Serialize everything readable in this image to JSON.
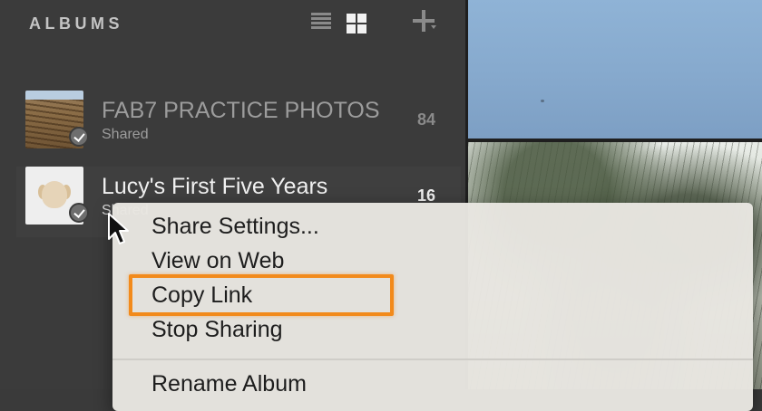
{
  "sidebar": {
    "title": "ALBUMS",
    "albums": [
      {
        "name": "FAB7 PRACTICE PHOTOS",
        "status": "Shared",
        "count": "84"
      },
      {
        "name": "Lucy's First Five Years",
        "status": "Shared",
        "count": "16"
      }
    ]
  },
  "context_menu": {
    "items": [
      "Share Settings...",
      "View on Web",
      "Copy Link",
      "Stop Sharing",
      "Rename Album"
    ],
    "highlighted": "Copy Link"
  },
  "icons": [
    "list-view-icon",
    "grid-view-icon",
    "add-icon",
    "shared-check-icon",
    "mouse-cursor-icon"
  ],
  "colors": {
    "sidebar_bg": "#3b3b3b",
    "menu_bg": "#e8e6e1",
    "highlight": "#f28a1b",
    "text_active": "#f0f0f0",
    "text_muted": "#9c9c9c"
  }
}
